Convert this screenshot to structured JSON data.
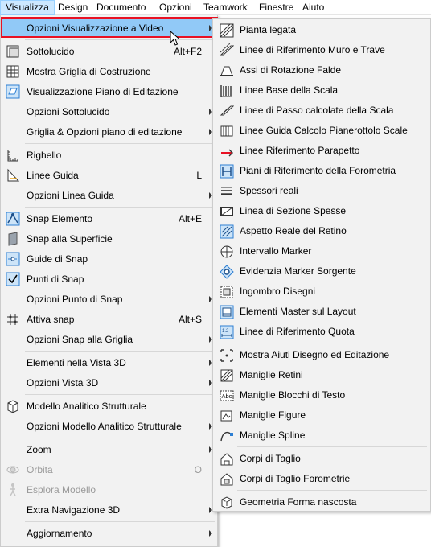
{
  "menubar": {
    "items": [
      "Visualizza",
      "Design",
      "Documento",
      "Opzioni",
      "Teamwork",
      "Finestre",
      "Aiuto"
    ]
  },
  "main_menu": {
    "opzioni_vis_video": "Opzioni Visualizzazione a Video",
    "sottolucido": "Sottolucido",
    "sottolucido_sc": "Alt+F2",
    "mostra_griglia": "Mostra Griglia di Costruzione",
    "vis_piano": "Visualizzazione Piano di Editazione",
    "opz_sottolucido": "Opzioni Sottolucido",
    "griglia_opzioni": "Griglia & Opzioni piano di editazione",
    "righello": "Righello",
    "linee_guida": "Linee Guida",
    "linee_guida_sc": "L",
    "opz_linea_guida": "Opzioni Linea Guida",
    "snap_elemento": "Snap Elemento",
    "snap_elemento_sc": "Alt+E",
    "snap_superficie": "Snap alla Superficie",
    "guide_snap": "Guide di Snap",
    "punti_snap": "Punti di Snap",
    "opz_punto_snap": "Opzioni Punto di Snap",
    "attiva_snap": "Attiva snap",
    "attiva_snap_sc": "Alt+S",
    "opz_snap_griglia": "Opzioni Snap alla Griglia",
    "elementi_3d": "Elementi nella Vista 3D",
    "opz_vista_3d": "Opzioni Vista 3D",
    "modello_analitico": "Modello Analitico Strutturale",
    "opz_modello_analitico": "Opzioni Modello Analitico Strutturale",
    "zoom": "Zoom",
    "orbita": "Orbita",
    "orbita_sc": "O",
    "esplora": "Esplora Modello",
    "extra_nav": "Extra Navigazione 3D",
    "aggiornamento": "Aggiornamento"
  },
  "sub_menu": {
    "items": [
      "Pianta legata",
      "Linee di Riferimento Muro e Trave",
      "Assi di Rotazione Falde",
      "Linee Base della Scala",
      "Linee di Passo calcolate della Scala",
      "Linee Guida Calcolo Pianerottolo Scale",
      "Linee Riferimento Parapetto",
      "Piani di Riferimento della Forometria",
      "Spessori reali",
      "Linea di Sezione Spesse",
      "Aspetto Reale del Retino",
      "Intervallo Marker",
      "Evidenzia Marker Sorgente",
      "Ingombro Disegni",
      "Elementi Master sul Layout",
      "Linee di Riferimento Quota",
      "Mostra Aiuti Disegno ed Editazione",
      "Maniglie Retini",
      "Maniglie Blocchi di Testo",
      "Maniglie Figure",
      "Maniglie Spline",
      "Corpi di Taglio",
      "Corpi di Taglio Forometrie",
      "Geometria Forma nascosta"
    ]
  },
  "colors": {
    "highlight": "#91c9f7",
    "highlight_border": "#e81123",
    "menu_bg": "#f2f2f2",
    "icon_blue": "#2d7fd3"
  }
}
